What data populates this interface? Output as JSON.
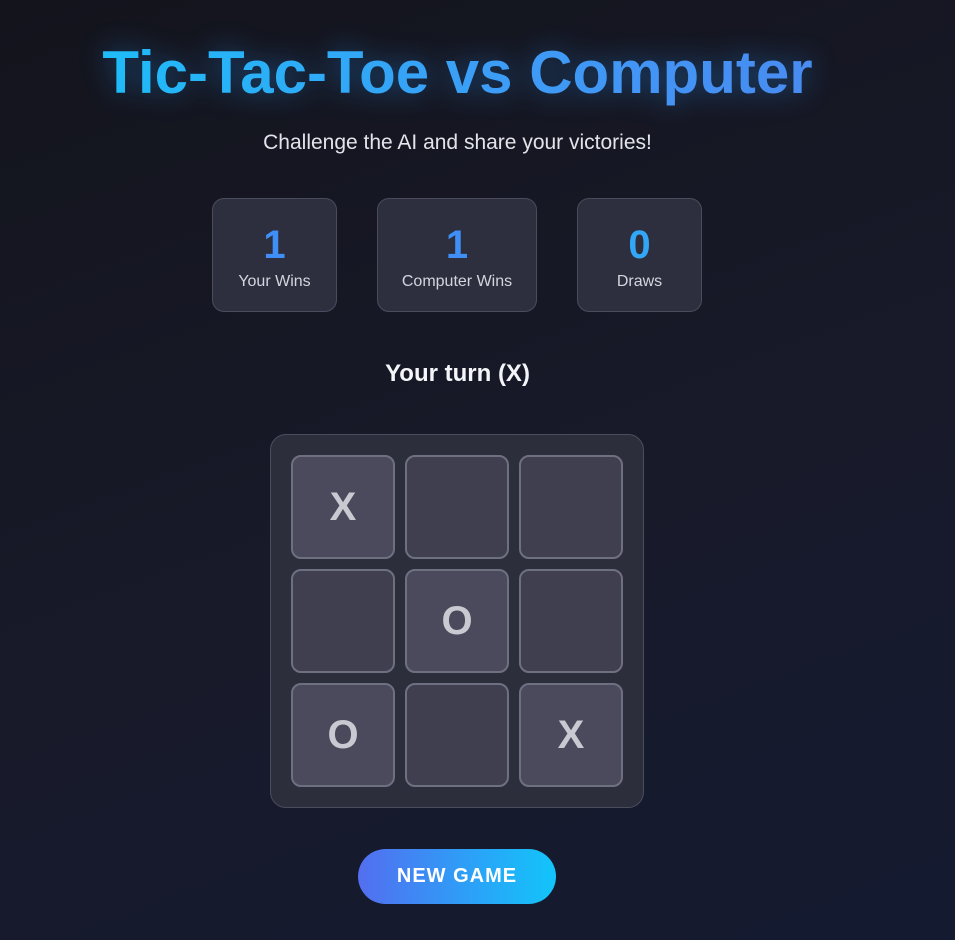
{
  "header": {
    "title": "Tic-Tac-Toe vs Computer",
    "subtitle": "Challenge the AI and share your victories!"
  },
  "scores": [
    {
      "value": "1",
      "label": "Your Wins"
    },
    {
      "value": "1",
      "label": "Computer Wins"
    },
    {
      "value": "0",
      "label": "Draws"
    }
  ],
  "status": "Your turn (X)",
  "board": [
    "X",
    "",
    "",
    "",
    "O",
    "",
    "O",
    "",
    "X"
  ],
  "controls": {
    "new_game_label": "NEW GAME"
  },
  "colors": {
    "accent_cyan": "#12c5fa",
    "accent_blue": "#3f8ff7",
    "accent_indigo": "#536ef0"
  }
}
